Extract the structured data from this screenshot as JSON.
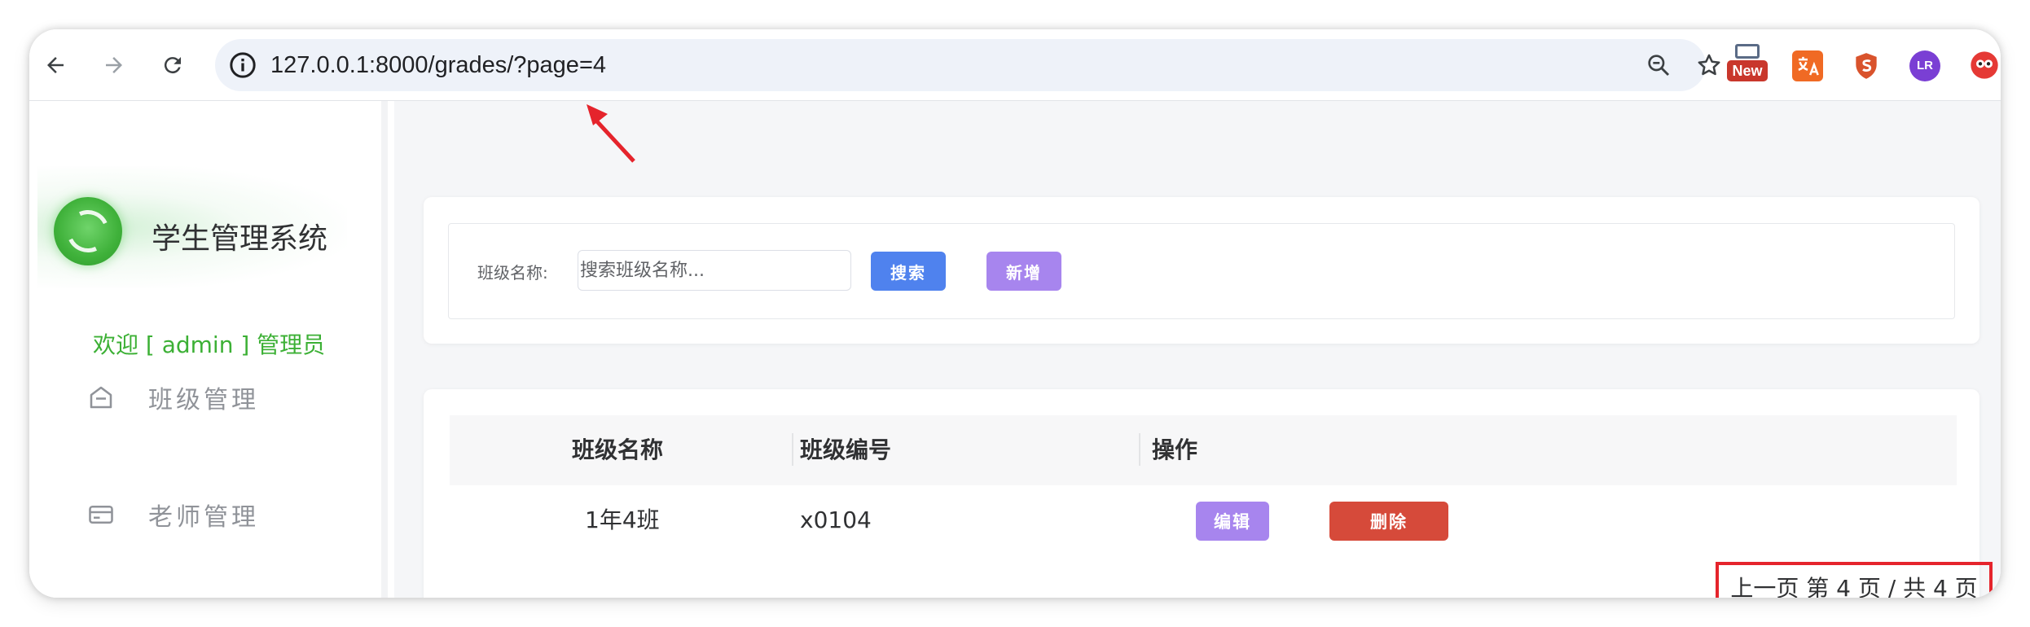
{
  "browser": {
    "url": "127.0.0.1:8000/grades/?page=4",
    "ext_new_badge": "New",
    "ext_avatar_text": "LR"
  },
  "sidebar": {
    "brand": "学生管理系统",
    "welcome": "欢迎 [ admin ] 管理员",
    "items": [
      {
        "label": "班级管理",
        "icon": "house-icon"
      },
      {
        "label": "老师管理",
        "icon": "card-icon"
      }
    ]
  },
  "search": {
    "label": "班级名称:",
    "placeholder": "搜索班级名称...",
    "search_button": "搜索",
    "add_button": "新增"
  },
  "table": {
    "headers": [
      "班级名称",
      "班级编号",
      "操作"
    ],
    "rows": [
      {
        "name": "1年4班",
        "code": "x0104",
        "edit": "编辑",
        "delete": "删除"
      }
    ]
  },
  "pagination": {
    "text": "上一页 第 4 页 / 共 4 页"
  },
  "colors": {
    "primary": "#4f82ee",
    "accent": "#a785ee",
    "danger": "#d64a3a",
    "success": "#3cb035",
    "annotation": "#e5242c"
  }
}
